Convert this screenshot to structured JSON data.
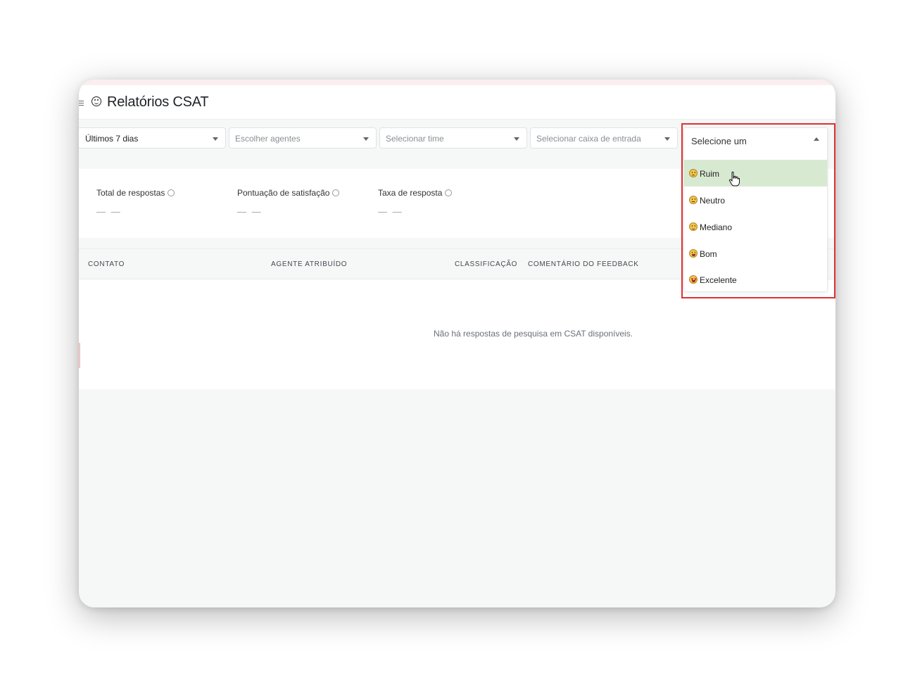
{
  "header": {
    "title": "Relatórios CSAT",
    "title_icon": "smile-icon",
    "menu_icon": "hamburger-menu-icon"
  },
  "filters": [
    {
      "label": "Últimos 7 dias",
      "placeholder": false
    },
    {
      "label": "Escolher agentes",
      "placeholder": true
    },
    {
      "label": "Selecionar time",
      "placeholder": true
    },
    {
      "label": "Selecionar caixa de entrada",
      "placeholder": true
    }
  ],
  "rating_dropdown": {
    "label": "Selecione um",
    "options": [
      {
        "label": "Ruim",
        "icon": "disappointed-face-icon",
        "highlighted": true
      },
      {
        "label": "Neutro",
        "icon": "expressionless-face-icon",
        "highlighted": false
      },
      {
        "label": "Mediano",
        "icon": "slightly-smiling-face-icon",
        "highlighted": false
      },
      {
        "label": "Bom",
        "icon": "grinning-face-icon",
        "highlighted": false
      },
      {
        "label": "Excelente",
        "icon": "star-struck-face-icon",
        "highlighted": false
      }
    ],
    "highlight_color": "#d7ead1",
    "callout_color": "#e0302f"
  },
  "metrics": [
    {
      "label": "Total de respostas",
      "value": "— —"
    },
    {
      "label": "Pontuação de satisfação",
      "value": "— —"
    },
    {
      "label": "Taxa de resposta",
      "value": "— —"
    }
  ],
  "table": {
    "columns": [
      "CONTATO",
      "AGENTE ATRIBUÍDO",
      "CLASSIFICAÇÃO",
      "COMENTÁRIO DO FEEDBACK"
    ],
    "empty_message": "Não há respostas de pesquisa em CSAT disponíveis."
  }
}
